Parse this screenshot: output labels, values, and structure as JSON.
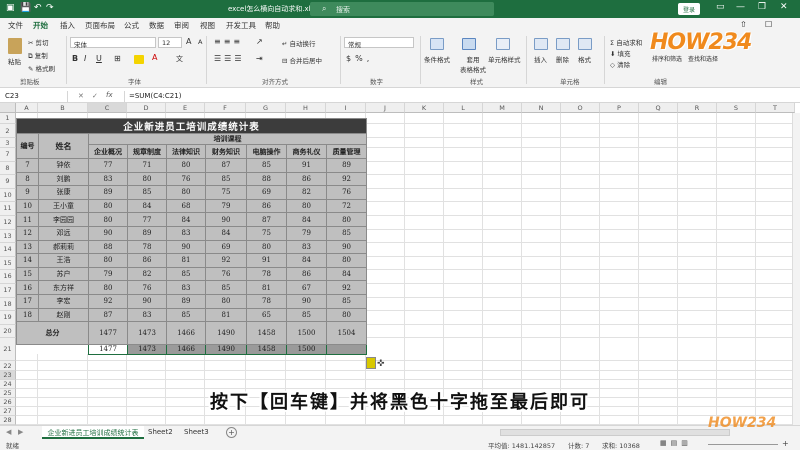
{
  "window": {
    "title": "excel怎么横向自动求和.xlsx - Excel",
    "search_placeholder": "搜索",
    "login": "登录",
    "controls": {
      "minimize": "—",
      "restore": "❐",
      "close": "✕"
    }
  },
  "menu": {
    "tabs": [
      "文件",
      "开始",
      "插入",
      "页面布局",
      "公式",
      "数据",
      "审阅",
      "视图",
      "开发工具",
      "帮助"
    ],
    "active": "开始"
  },
  "ribbon": {
    "clipboard": {
      "paste": "粘贴",
      "cut": "剪切",
      "copy": "复制",
      "format_painter": "格式刷",
      "label": "剪贴板"
    },
    "font": {
      "font_name": "宋体",
      "font_size": "12",
      "bold": "B",
      "italic": "I",
      "underline": "U",
      "label": "字体"
    },
    "alignment": {
      "wrap": "自动换行",
      "merge": "合并后居中",
      "label": "对齐方式"
    },
    "number": {
      "format": "常规",
      "label": "数字"
    },
    "styles": {
      "conditional": "条件格式",
      "table_format": "套用\n表格格式",
      "cell_styles": "单元格样式",
      "label": "样式"
    },
    "cells": {
      "insert": "插入",
      "delete": "删除",
      "format": "格式",
      "label": "单元格"
    },
    "editing": {
      "autosum": "自动求和",
      "fill": "填充",
      "clear": "清除",
      "sort": "排序和筛选",
      "find": "查找和选择",
      "label": "编辑"
    }
  },
  "formula_bar": {
    "name_box": "C23",
    "fx": "fx",
    "formula": "=SUM(C4:C21)"
  },
  "columns": [
    "A",
    "B",
    "C",
    "D",
    "E",
    "F",
    "G",
    "H",
    "I",
    "J",
    "K",
    "L",
    "M",
    "N",
    "O",
    "P",
    "Q",
    "R",
    "S",
    "T"
  ],
  "table": {
    "title": "企业新进员工培训成绩统计表",
    "head_id": "编号",
    "head_name": "姓名",
    "head_group": "培训课程",
    "courses": [
      "企业概况",
      "规章制度",
      "法律知识",
      "财务知识",
      "电脑操作",
      "商务礼仪",
      "质量管理"
    ],
    "rows": [
      {
        "id": "7",
        "name": "钟依",
        "scores": [
          "77",
          "71",
          "80",
          "87",
          "85",
          "91",
          "89"
        ]
      },
      {
        "id": "8",
        "name": "刘鹏",
        "scores": [
          "83",
          "80",
          "76",
          "85",
          "88",
          "86",
          "92"
        ]
      },
      {
        "id": "9",
        "name": "张康",
        "scores": [
          "89",
          "85",
          "80",
          "75",
          "69",
          "82",
          "76"
        ]
      },
      {
        "id": "10",
        "name": "王小童",
        "scores": [
          "80",
          "84",
          "68",
          "79",
          "86",
          "80",
          "72"
        ]
      },
      {
        "id": "11",
        "name": "李园园",
        "scores": [
          "80",
          "77",
          "84",
          "90",
          "87",
          "84",
          "80"
        ]
      },
      {
        "id": "12",
        "name": "邓远",
        "scores": [
          "90",
          "89",
          "83",
          "84",
          "75",
          "79",
          "85"
        ]
      },
      {
        "id": "13",
        "name": "郝莉莉",
        "scores": [
          "88",
          "78",
          "90",
          "69",
          "80",
          "83",
          "90"
        ]
      },
      {
        "id": "14",
        "name": "王浩",
        "scores": [
          "80",
          "86",
          "81",
          "92",
          "91",
          "84",
          "80"
        ]
      },
      {
        "id": "15",
        "name": "苏户",
        "scores": [
          "79",
          "82",
          "85",
          "76",
          "78",
          "86",
          "84"
        ]
      },
      {
        "id": "16",
        "name": "东方祥",
        "scores": [
          "80",
          "76",
          "83",
          "85",
          "81",
          "67",
          "92"
        ]
      },
      {
        "id": "17",
        "name": "李宏",
        "scores": [
          "92",
          "90",
          "89",
          "80",
          "78",
          "90",
          "85"
        ]
      },
      {
        "id": "18",
        "name": "赵刚",
        "scores": [
          "87",
          "83",
          "85",
          "81",
          "65",
          "85",
          "80"
        ]
      }
    ],
    "total_label": "总分",
    "totals": [
      "1477",
      "1473",
      "1466",
      "1490",
      "1458",
      "1500",
      "1504"
    ],
    "row23": [
      "1477",
      "1473",
      "1466",
      "1490",
      "1458",
      "1500",
      ""
    ],
    "row_numbers": [
      "1",
      "2",
      "3",
      "7",
      "8",
      "9",
      "10",
      "11",
      "12",
      "13",
      "14",
      "15",
      "16",
      "17",
      "18",
      "19",
      "20",
      "21",
      "22",
      "23",
      "24",
      "25",
      "26",
      "27",
      "28",
      "29"
    ]
  },
  "sheets": {
    "tabs": [
      "企业新进员工培训成绩统计表",
      "Sheet2",
      "Sheet3"
    ],
    "add": "+"
  },
  "status": {
    "ready": "就绪",
    "average": "平均值: 1481.142857",
    "count": "计数: 7",
    "sum": "求和: 10368",
    "zoom": "+"
  },
  "subtitle": "按下【回车键】并将黑色十字拖至最后即可",
  "watermark": "HOW234",
  "colors": {
    "excel_green": "#1e6e3f",
    "table_dark": "#3c3c3c",
    "cell_gray": "#bfbfbf",
    "sel_gray": "#9a9a9a",
    "logo_orange": "#f08a1d"
  }
}
